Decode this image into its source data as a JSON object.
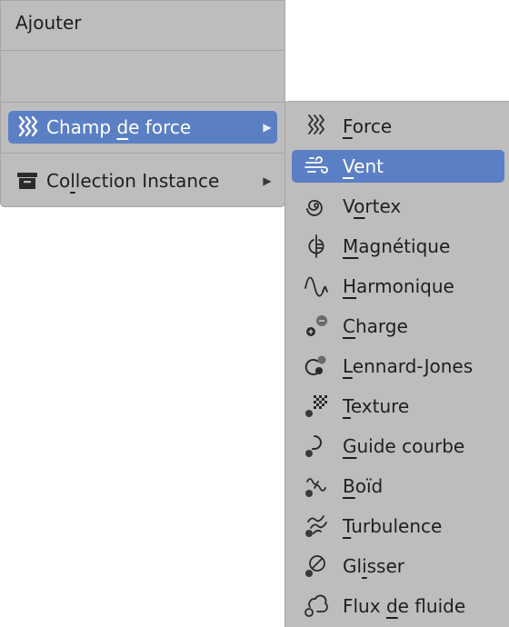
{
  "main_menu": {
    "title": "Ajouter",
    "items": [
      {
        "label_pre": "Champ ",
        "label_ul": "d",
        "label_post": "e force",
        "icon": "force-field-icon",
        "has_submenu": true,
        "active": true
      },
      {
        "label_pre": "Co",
        "label_ul": "l",
        "label_post": "lection Instance",
        "icon": "collection-icon",
        "has_submenu": true,
        "active": false
      }
    ],
    "submenu_arrow": "▶"
  },
  "submenu": {
    "items": [
      {
        "ul": "F",
        "rest": "orce",
        "icon": "force-icon"
      },
      {
        "ul": "V",
        "rest": "ent",
        "icon": "wind-icon",
        "active": true
      },
      {
        "ul": "",
        "pre": "V",
        "mid": "o",
        "rest": "rtex",
        "icon": "vortex-icon"
      },
      {
        "ul": "M",
        "rest": "agnétique",
        "icon": "magnetic-icon"
      },
      {
        "ul": "H",
        "rest": "armonique",
        "icon": "harmonic-icon"
      },
      {
        "ul": "C",
        "rest": "harge",
        "icon": "charge-icon"
      },
      {
        "ul": "L",
        "rest": "ennard-Jones",
        "icon": "lennard-jones-icon"
      },
      {
        "ul": "T",
        "rest": "exture",
        "icon": "texture-icon"
      },
      {
        "ul": "G",
        "rest": "uide courbe",
        "icon": "curve-guide-icon"
      },
      {
        "ul": "B",
        "rest": "oïd",
        "icon": "boid-icon"
      },
      {
        "ul": "T",
        "rest": "urbulence",
        "icon": "turbulence-icon"
      },
      {
        "pre": "Gl",
        "mid": "i",
        "rest": "sser",
        "icon": "drag-icon"
      },
      {
        "pre": "Flux ",
        "mid": "d",
        "rest": "e fluide",
        "icon": "fluid-flow-icon"
      }
    ]
  },
  "colors": {
    "menu_bg": "#bdbdbd",
    "highlight": "#5b7fc5",
    "text": "#1f1f1f"
  }
}
